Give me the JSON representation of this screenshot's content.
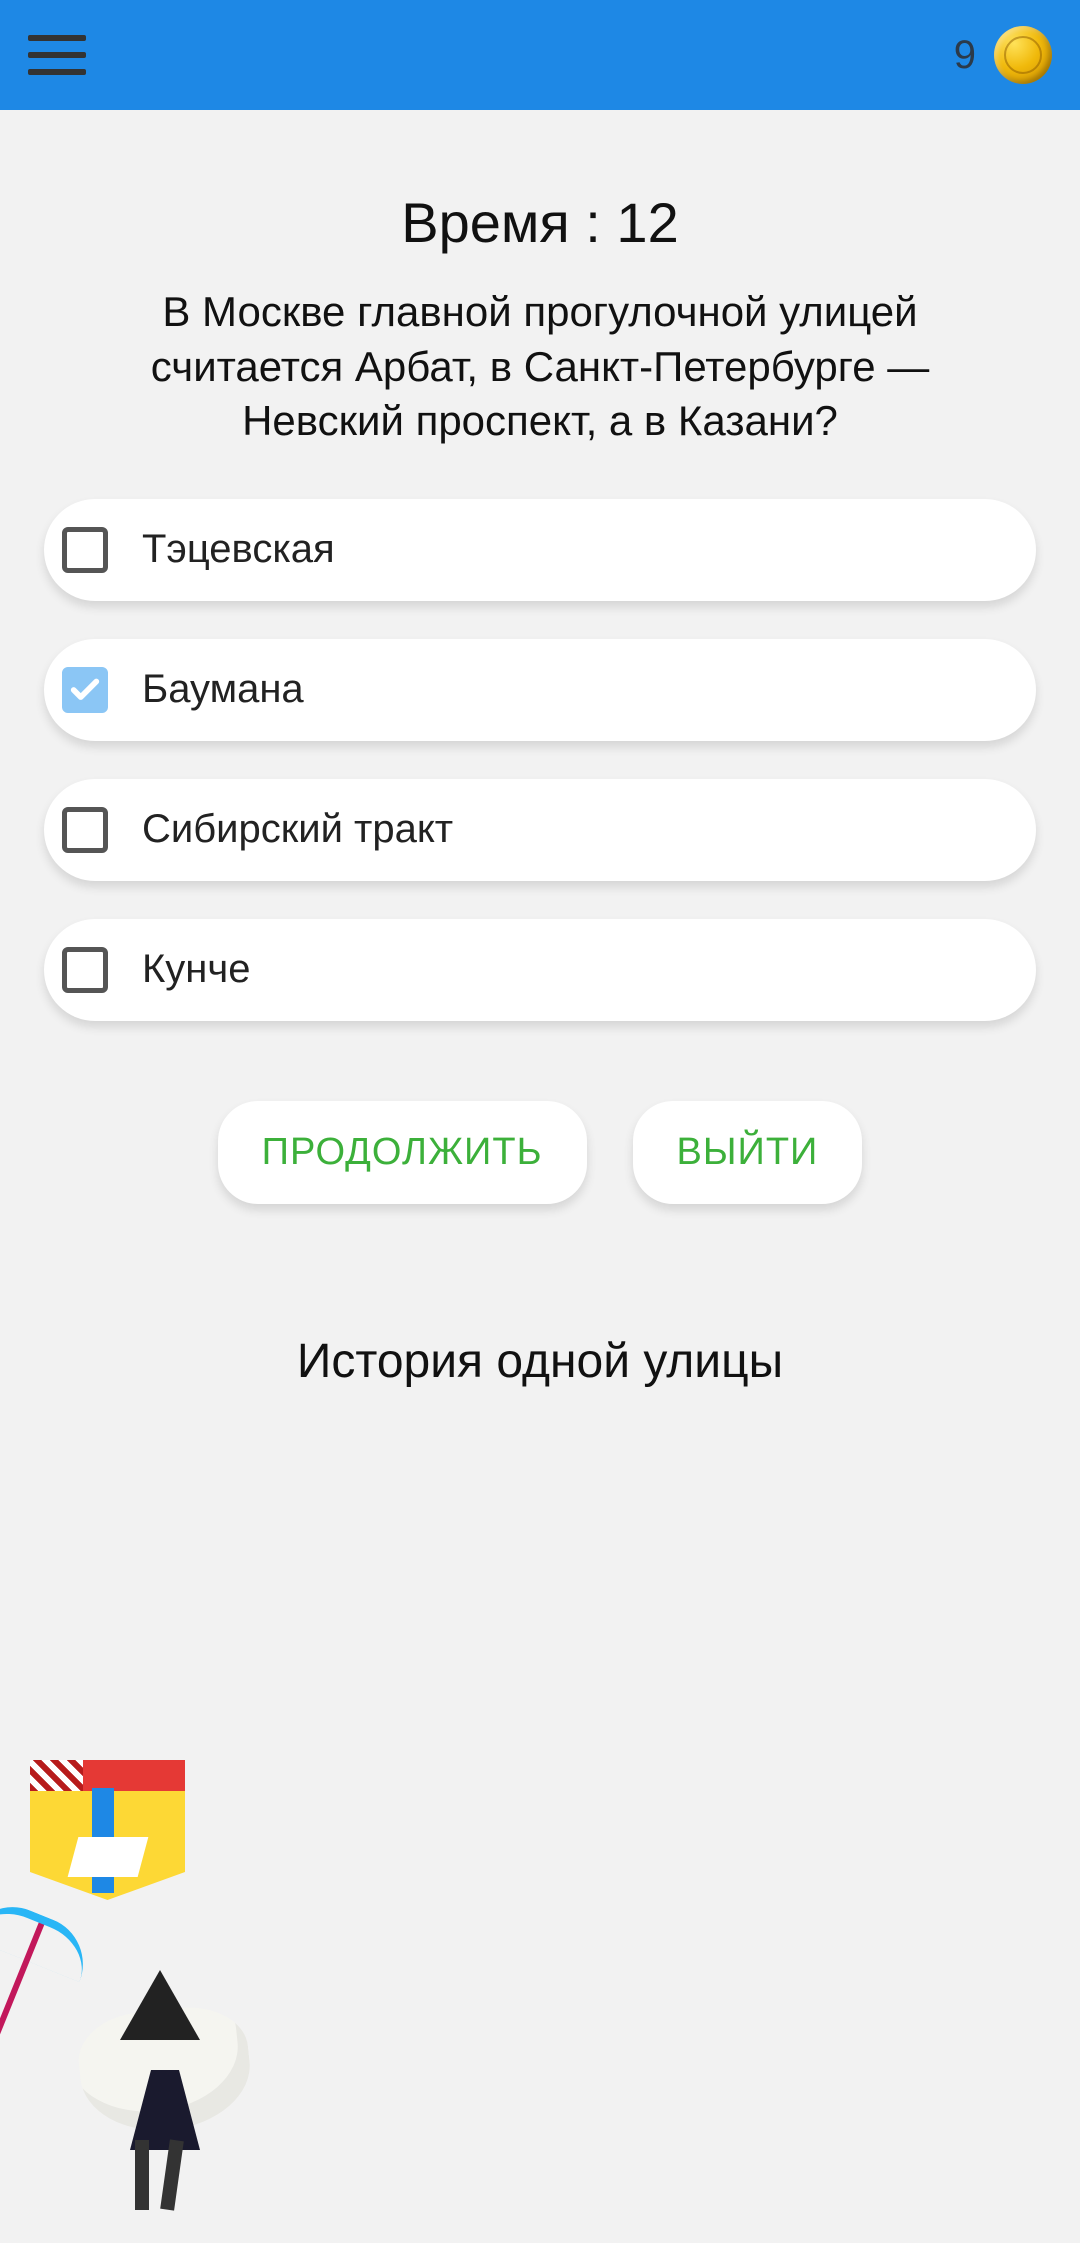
{
  "header": {
    "coin_count": "9"
  },
  "quiz": {
    "timer_label": "Время : 12",
    "timer_value": 12,
    "question": "В Москве главной прогулочной улицей считается Арбат, в Санкт-Петербурге —Невский проспект, а в Казани?",
    "options": [
      {
        "label": "Тэцевская",
        "checked": false
      },
      {
        "label": "Баумана",
        "checked": true
      },
      {
        "label": "Сибирский тракт",
        "checked": false
      },
      {
        "label": "Кунче",
        "checked": false
      }
    ],
    "continue_label": "ПРОДОЛЖИТЬ",
    "exit_label": "ВЫЙТИ"
  },
  "subtitle": "История одной улицы"
}
